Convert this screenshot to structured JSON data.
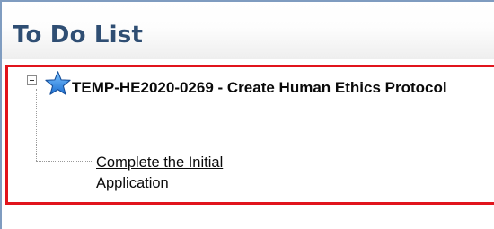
{
  "panel": {
    "title": "To Do List"
  },
  "tree": {
    "node": {
      "icon": "star-icon",
      "title": "TEMP-HE2020-0269 - Create Human Ethics Protocol",
      "collapse_icon": "minus-box-icon"
    },
    "tasks": [
      {
        "label": "Complete the Initial Application"
      }
    ]
  },
  "colors": {
    "title": "#2f4e73",
    "highlight_border": "#e1141c",
    "star_fill": "#3a8ee6",
    "panel_border": "#7f9cc0"
  }
}
